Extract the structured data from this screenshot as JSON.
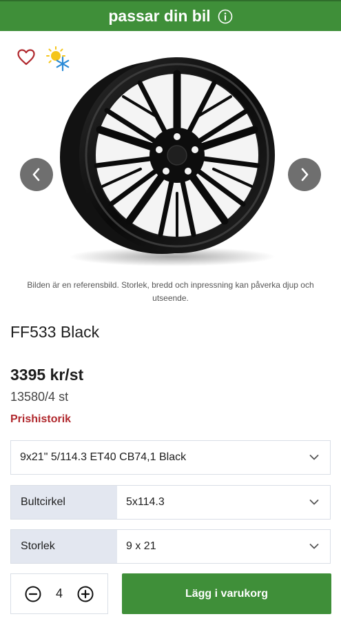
{
  "header": {
    "title": "passar din bil",
    "info_icon": "info-circle-icon",
    "bg_color": "#3f8f39"
  },
  "gallery": {
    "favorite_icon": "heart-outline-icon",
    "season_icon": "sun-snowflake-icon",
    "prev_icon": "chevron-left-icon",
    "next_icon": "chevron-right-icon",
    "disclaimer": "Bilden är en referensbild. Storlek, bredd och inpressning kan påverka djup och utseende."
  },
  "product": {
    "title": "FF533 Black",
    "price_per_unit": "3395 kr/st",
    "price_total": "13580/4 st",
    "price_history_label": "Prishistorik"
  },
  "variant_select": {
    "value": "9x21\" 5/114.3 ET40 CB74,1 Black"
  },
  "bolt_circle": {
    "label": "Bultcirkel",
    "value": "5x114.3"
  },
  "size": {
    "label": "Storlek",
    "value": "9 x 21"
  },
  "quantity": {
    "value": "4",
    "minus_icon": "minus-circle-icon",
    "plus_icon": "plus-circle-icon"
  },
  "cart_button": {
    "label": "Lägg i varukorg",
    "color": "#3f8f39"
  },
  "colors": {
    "price_history": "#b0282d",
    "select_label_bg": "#e3e7f0"
  }
}
